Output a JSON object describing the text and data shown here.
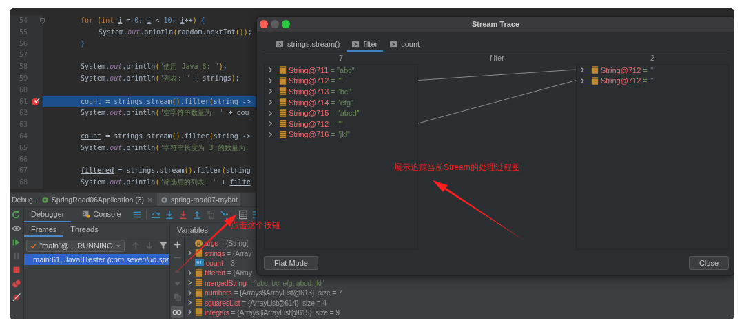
{
  "editor": {
    "lines": [
      {
        "number": "54",
        "breakpoint": false,
        "current": false,
        "segments": [
          {
            "kind": "kw",
            "text": "for "
          },
          {
            "kind": "paren",
            "text": "("
          },
          {
            "kind": "kw",
            "text": "int "
          },
          {
            "kind": "ref",
            "text": "i"
          },
          {
            "kind": "plain",
            "text": " = "
          },
          {
            "kind": "num",
            "text": "0"
          },
          {
            "kind": "plain",
            "text": "; "
          },
          {
            "kind": "ref",
            "text": "i"
          },
          {
            "kind": "plain",
            "text": " < "
          },
          {
            "kind": "num",
            "text": "10"
          },
          {
            "kind": "plain",
            "text": "; "
          },
          {
            "kind": "ref",
            "text": "i"
          },
          {
            "kind": "plain",
            "text": "++"
          },
          {
            "kind": "paren",
            "text": ")"
          },
          {
            "kind": "brace",
            "text": " {"
          }
        ],
        "children": [
          {
            "number": "55",
            "breakpoint": false,
            "current": false,
            "segments": [
              {
                "kind": "plain",
                "text": "System."
              },
              {
                "kind": "field",
                "text": "out"
              },
              {
                "kind": "plain",
                "text": ".println"
              },
              {
                "kind": "paren",
                "text": "("
              },
              {
                "kind": "plain",
                "text": "random.nextInt"
              },
              {
                "kind": "paren",
                "text": "()"
              },
              {
                "kind": "paren",
                "text": ")"
              },
              {
                "kind": "plain",
                "text": ";"
              }
            ]
          }
        ]
      },
      {
        "number": "56",
        "breakpoint": false,
        "current": false,
        "segments": [
          {
            "kind": "brace",
            "text": "}"
          }
        ]
      },
      {
        "number": "57",
        "breakpoint": false,
        "current": false
      },
      {
        "number": "58",
        "breakpoint": false,
        "current": false,
        "segments": [
          {
            "kind": "plain",
            "text": "System."
          },
          {
            "kind": "field",
            "text": "out"
          },
          {
            "kind": "plain",
            "text": ".println"
          },
          {
            "kind": "paren",
            "text": "("
          },
          {
            "kind": "str",
            "text": "\"使用 Java 8: \""
          },
          {
            "kind": "paren",
            "text": ")"
          },
          {
            "kind": "plain",
            "text": ";"
          }
        ]
      },
      {
        "number": "59",
        "breakpoint": false,
        "current": false,
        "segments": [
          {
            "kind": "plain",
            "text": "System."
          },
          {
            "kind": "field",
            "text": "out"
          },
          {
            "kind": "plain",
            "text": ".println"
          },
          {
            "kind": "paren",
            "text": "("
          },
          {
            "kind": "str",
            "text": "\"列表: \""
          },
          {
            "kind": "plain",
            "text": " + strings"
          },
          {
            "kind": "paren",
            "text": ")"
          },
          {
            "kind": "plain",
            "text": ";"
          }
        ]
      },
      {
        "number": "60",
        "breakpoint": false,
        "current": false
      },
      {
        "number": "61",
        "breakpoint": true,
        "current": true,
        "segments": [
          {
            "kind": "ref",
            "text": "count"
          },
          {
            "kind": "plain",
            "text": " = strings.stream"
          },
          {
            "kind": "paren",
            "text": "()"
          },
          {
            "kind": "plain",
            "text": ".filter"
          },
          {
            "kind": "paren",
            "text": "("
          },
          {
            "kind": "plain",
            "text": "string ->"
          }
        ]
      },
      {
        "number": "62",
        "breakpoint": false,
        "current": false,
        "segments": [
          {
            "kind": "plain",
            "text": "System."
          },
          {
            "kind": "field",
            "text": "out"
          },
          {
            "kind": "plain",
            "text": ".println"
          },
          {
            "kind": "paren",
            "text": "("
          },
          {
            "kind": "str",
            "text": "\"空字符串数量为: \""
          },
          {
            "kind": "plain",
            "text": " + "
          },
          {
            "kind": "ref",
            "text": "cou"
          }
        ]
      },
      {
        "number": "63",
        "breakpoint": false,
        "current": false
      },
      {
        "number": "64",
        "breakpoint": false,
        "current": false,
        "segments": [
          {
            "kind": "ref",
            "text": "count"
          },
          {
            "kind": "plain",
            "text": " = strings.stream"
          },
          {
            "kind": "paren",
            "text": "()"
          },
          {
            "kind": "plain",
            "text": ".filter"
          },
          {
            "kind": "paren",
            "text": "("
          },
          {
            "kind": "plain",
            "text": "string ->"
          }
        ]
      },
      {
        "number": "65",
        "breakpoint": false,
        "current": false,
        "segments": [
          {
            "kind": "plain",
            "text": "System."
          },
          {
            "kind": "field",
            "text": "out"
          },
          {
            "kind": "plain",
            "text": ".println"
          },
          {
            "kind": "paren",
            "text": "("
          },
          {
            "kind": "str",
            "text": "\"字符串长度为 3 的数量为:"
          }
        ]
      },
      {
        "number": "66",
        "breakpoint": false,
        "current": false
      },
      {
        "number": "67",
        "breakpoint": false,
        "current": false,
        "segments": [
          {
            "kind": "ref",
            "text": "filtered"
          },
          {
            "kind": "plain",
            "text": " = strings.stream"
          },
          {
            "kind": "paren",
            "text": "()"
          },
          {
            "kind": "plain",
            "text": ".filter"
          },
          {
            "kind": "paren",
            "text": "("
          },
          {
            "kind": "plain",
            "text": "string"
          }
        ]
      },
      {
        "number": "68",
        "breakpoint": false,
        "current": false,
        "segments": [
          {
            "kind": "plain",
            "text": "System."
          },
          {
            "kind": "field",
            "text": "out"
          },
          {
            "kind": "plain",
            "text": ".println"
          },
          {
            "kind": "paren",
            "text": "("
          },
          {
            "kind": "str",
            "text": "\"筛选后的列表: \""
          },
          {
            "kind": "plain",
            "text": " + "
          },
          {
            "kind": "ref",
            "text": "filte"
          }
        ]
      }
    ]
  },
  "debug": {
    "label": "Debug:",
    "sessions": [
      {
        "label": "SpringRoad06Application (3)",
        "selected": false
      },
      {
        "label": "spring-road07-mybat",
        "selected": true
      }
    ],
    "tabs": [
      {
        "label": "Debugger",
        "selected": true
      },
      {
        "label": "Console",
        "selected": false
      }
    ],
    "frame_tabs": [
      {
        "label": "Frames",
        "selected": true
      },
      {
        "label": "Threads",
        "selected": false
      }
    ],
    "thread": {
      "value": "\"main\"@... RUNNING"
    },
    "frames": [
      {
        "text": "main:61, Java8Tester ",
        "location": "(com.sevenluo.spr",
        "selected": true
      }
    ],
    "variables": {
      "title": "Variables",
      "rows": [
        {
          "kind": "param",
          "icon_text": "p",
          "expandable": false,
          "name": "args",
          "value": "= {String["
        },
        {
          "kind": "object",
          "expandable": true,
          "name": "strings",
          "value": "= {Array"
        },
        {
          "kind": "primitive",
          "icon_text": "01",
          "expandable": false,
          "name": "count",
          "value": "= 3"
        },
        {
          "kind": "object",
          "expandable": true,
          "name": "filtered",
          "value": "= {Array"
        },
        {
          "kind": "string",
          "expandable": true,
          "name": "mergedString",
          "value": "= \"abc, bc, efg, abcd, jkl\""
        },
        {
          "kind": "object",
          "expandable": true,
          "name": "numbers",
          "value": "= {Arrays$ArrayList@613}",
          "size": "size = 7"
        },
        {
          "kind": "object",
          "expandable": true,
          "name": "squaresList",
          "value": "= {ArrayList@614}",
          "size": "size = 4"
        },
        {
          "kind": "object",
          "expandable": true,
          "name": "integers",
          "value": "= {Arrays$ArrayList@615}",
          "size": "size = 9"
        }
      ]
    }
  },
  "stream_trace": {
    "title": "Stream Trace",
    "tabs": [
      {
        "label": "strings.stream()",
        "selected": false
      },
      {
        "label": "filter",
        "selected": true
      },
      {
        "label": "count",
        "selected": false
      }
    ],
    "columns": [
      "7",
      "filter",
      "2"
    ],
    "input": [
      {
        "name": "String@711",
        "value": "= \"abc\"",
        "passed": false
      },
      {
        "name": "String@712",
        "value": "= \"\"",
        "passed": true
      },
      {
        "name": "String@713",
        "value": "= \"bc\"",
        "passed": false
      },
      {
        "name": "String@714",
        "value": "= \"efg\"",
        "passed": false
      },
      {
        "name": "String@715",
        "value": "= \"abcd\"",
        "passed": false
      },
      {
        "name": "String@712",
        "value": "= \"\"",
        "passed": true
      },
      {
        "name": "String@716",
        "value": "= \"jkl\"",
        "passed": false
      }
    ],
    "output": [
      {
        "name": "String@712",
        "value": "= \"\""
      },
      {
        "name": "String@712",
        "value": "= \"\""
      }
    ],
    "buttons": [
      "Flat Mode",
      "Close"
    ]
  },
  "annotations": [
    "点击这个按钮",
    "展示追踪当前Stream的处理过程图"
  ]
}
